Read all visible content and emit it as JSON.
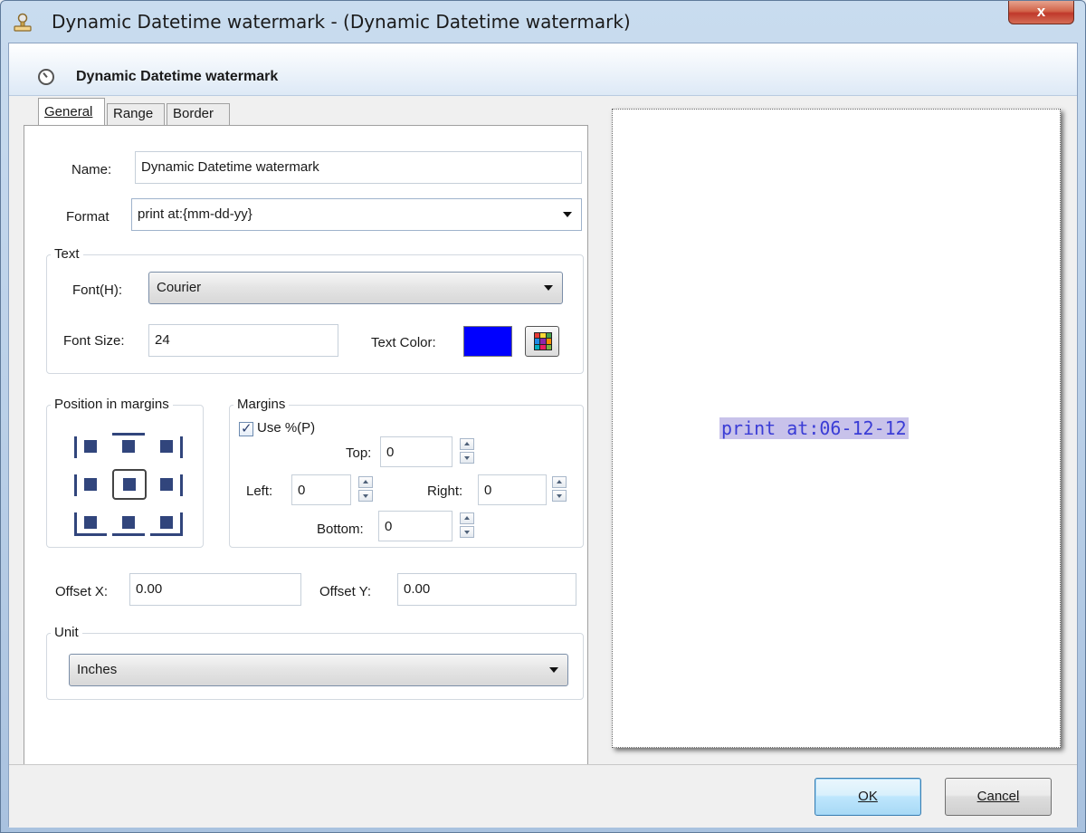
{
  "window": {
    "title": "Dynamic Datetime watermark - (Dynamic Datetime watermark)",
    "close_label": "x"
  },
  "header": {
    "title": "Dynamic Datetime watermark"
  },
  "tabs": [
    {
      "label": "General",
      "active": true
    },
    {
      "label": "Range",
      "active": false
    },
    {
      "label": "Border",
      "active": false
    }
  ],
  "general": {
    "name_label": "Name:",
    "name_value": "Dynamic Datetime watermark",
    "format_label": "Format",
    "format_value": "print at:{mm-dd-yy}",
    "text_group": "Text",
    "font_label": "Font(H):",
    "font_value": "Courier",
    "font_size_label": "Font Size:",
    "font_size_value": "24",
    "text_color_label": "Text Color:",
    "text_color": "#0000ff",
    "position_group": "Position in margins",
    "selected_position": "center",
    "margins_group": "Margins",
    "use_percent_label": "Use %(P)",
    "use_percent_checked": true,
    "top_label": "Top:",
    "top_value": "0",
    "left_label": "Left:",
    "left_value": "0",
    "right_label": "Right:",
    "right_value": "0",
    "bottom_label": "Bottom:",
    "bottom_value": "0",
    "offset_x_label": "Offset X:",
    "offset_x_value": "0.00",
    "offset_y_label": "Offset Y:",
    "offset_y_value": "0.00",
    "unit_group": "Unit",
    "unit_value": "Inches"
  },
  "preview": {
    "text": "print at:06-12-12"
  },
  "footer": {
    "ok_label": "OK",
    "cancel_label": "Cancel"
  }
}
